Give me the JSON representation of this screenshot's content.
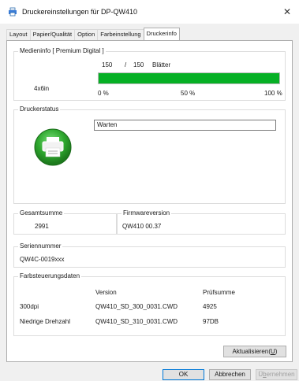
{
  "window": {
    "title": "Druckereinstellungen für DP-QW410",
    "close_glyph": "✕"
  },
  "tabs": [
    {
      "label": "Layout"
    },
    {
      "label": "Papier/Qualität"
    },
    {
      "label": "Option"
    },
    {
      "label": "Farbeinstellung"
    },
    {
      "label": "Druckerinfo",
      "active": true
    }
  ],
  "media_info": {
    "group_label": "Medieninfo [ Premium Digital ]",
    "count_current": "150",
    "separator": "/",
    "count_total": "150",
    "count_unit": "Blätter",
    "paper_size": "4x6in",
    "level_fraction": 1.0,
    "scale": [
      "0 %",
      "50 %",
      "100 %"
    ]
  },
  "printer_status": {
    "group_label": "Druckerstatus",
    "status_value": "Warten",
    "icon": "printer-status-ok-icon"
  },
  "total": {
    "group_label": "Gesamtsumme",
    "value": "2991"
  },
  "firmware": {
    "group_label": "Firmwareversion",
    "value": "QW410 00.37"
  },
  "serial": {
    "group_label": "Seriennummer",
    "value": "QW4C-0019xxx"
  },
  "color_control": {
    "group_label": "Farbsteuerungsdaten",
    "header_version": "Version",
    "header_checksum": "Prüfsumme",
    "rows": [
      {
        "name": "300dpi",
        "version": "QW410_SD_300_0031.CWD",
        "checksum": "4925"
      },
      {
        "name": "Niedrige Drehzahl",
        "version": "QW410_SD_310_0031.CWD",
        "checksum": "97DB"
      }
    ]
  },
  "buttons": {
    "refresh_prefix": "Aktualisieren(",
    "refresh_key": "U",
    "refresh_suffix": ")",
    "ok": "OK",
    "cancel": "Abbrechen",
    "apply_prefix": "Ü",
    "apply_key": "b",
    "apply_suffix": "ernehmen"
  },
  "colors": {
    "progress_fill": "#06b025",
    "status_icon_green": "#2fa82f"
  }
}
